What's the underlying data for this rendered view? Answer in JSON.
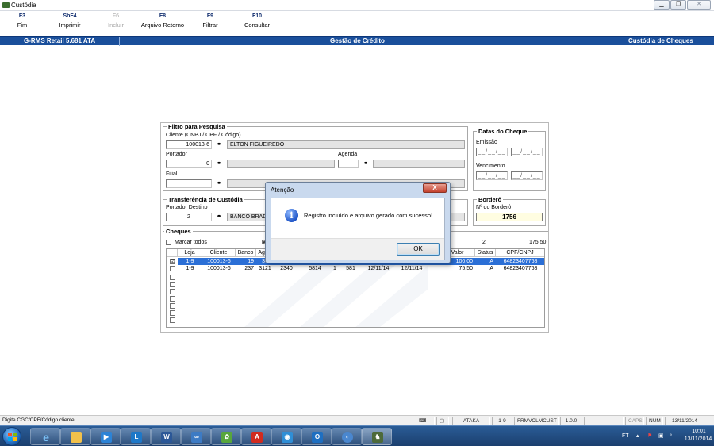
{
  "window": {
    "title": "Custódia"
  },
  "fkeys": [
    {
      "key": "F3",
      "label": "Fim",
      "enabled": true
    },
    {
      "key": "ShF4",
      "label": "Imprimir",
      "enabled": true
    },
    {
      "key": "F6",
      "label": "Incluir",
      "enabled": false
    },
    {
      "key": "F8",
      "label": "Arquivo Retorno",
      "enabled": true
    },
    {
      "key": "F9",
      "label": "Filtrar",
      "enabled": true
    },
    {
      "key": "F10",
      "label": "Consultar",
      "enabled": true
    }
  ],
  "header": {
    "app": "G-RMS Retail 5.681 ATA",
    "module": "Gestão de Crédito",
    "screen": "Custódia de Cheques"
  },
  "filtro": {
    "title": "Filtro para Pesquisa",
    "cliente_label": "Cliente (CNPJ / CPF / Código)",
    "cliente_value": "100013-6",
    "cliente_nome": "ELTON FIGUEIREDO",
    "portador_label": "Portador",
    "portador_value": "0",
    "agenda_label": "Agenda",
    "filial_label": "Filial"
  },
  "datas": {
    "title": "Datas do Cheque",
    "emissao_label": "Emissão",
    "vencimento_label": "Vencimento",
    "placeholder": "__/__/__"
  },
  "transferencia": {
    "title": "Transferência de Custódia",
    "portador_destino_label": "Portador Destino",
    "portador_destino_value": "2",
    "portador_destino_nome": "BANCO BRADE"
  },
  "bordero": {
    "title": "Borderô",
    "numero_label": "Nº do Borderô",
    "numero_value": "1756"
  },
  "cheques": {
    "title": "Cheques",
    "marcar_todos": "Marcar todos",
    "partial_label": "M",
    "count": "2",
    "total": "175,50",
    "columns": [
      "Loja",
      "Cliente",
      "Banco",
      "Agen",
      "Valor",
      "Status",
      "CPF/CNPJ"
    ],
    "rows": [
      {
        "checked": "☑",
        "loja": "1-9",
        "cliente": "100013-6",
        "banco": "19",
        "agencia": "34",
        "conta": "",
        "num1": "",
        "num2": "",
        "data1": "",
        "data2": "",
        "valor": "100,00",
        "status": "A",
        "cpf": "64823407768"
      },
      {
        "checked": "",
        "loja": "1-9",
        "cliente": "100013-6",
        "banco": "237",
        "agencia": "3121",
        "conta": "2340",
        "num1": "5814",
        "num2": "1",
        "num3": "581",
        "data1": "12/11/14",
        "data2": "12/11/14",
        "valor": "75,50",
        "status": "A",
        "cpf": "64823407768"
      }
    ]
  },
  "modal": {
    "title": "Atenção",
    "close_label": "X",
    "message": "Registro incluído e arquivo gerado com sucesso!",
    "ok_label": "OK"
  },
  "statusbar": {
    "hint": "Digite CGC/CPF/Código cliente",
    "user": "ATAKA",
    "loja": "1-9",
    "form": "FRMVCLMCUST",
    "version": "1.0.0",
    "caps": "CAPS",
    "num": "NUM",
    "date": "13/11/2014"
  },
  "tray": {
    "lang": "FT",
    "time": "10:01",
    "date": "13/11/2014"
  }
}
